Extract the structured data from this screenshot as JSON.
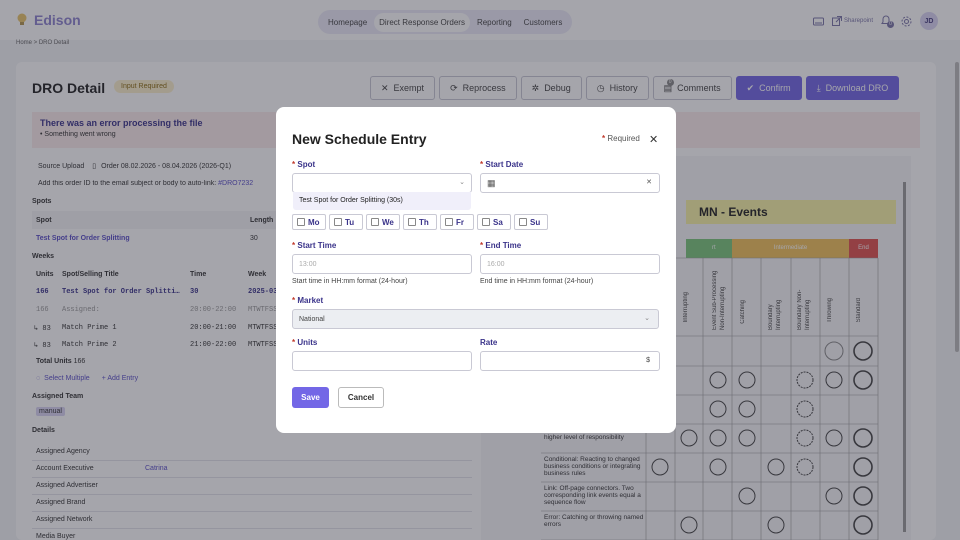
{
  "app": {
    "name": "Edison"
  },
  "nav": {
    "items": [
      "Homepage",
      "Direct Response Orders",
      "Reporting",
      "Customers"
    ]
  },
  "topright": {
    "sharepoint": "Sharepoint",
    "avatar": "JD",
    "notif_count": "0"
  },
  "breadcrumb": "Home > DRO Detail",
  "page": {
    "title": "DRO Detail",
    "status": "Input Required"
  },
  "toolbar": {
    "exempt": "Exempt",
    "reprocess": "Reprocess",
    "debug": "Debug",
    "history": "History",
    "comments": "Comments",
    "comments_count": "0",
    "confirm": "Confirm",
    "download": "Download DRO"
  },
  "error": {
    "title": "There was an error processing the file",
    "item": "Something went wrong"
  },
  "source": {
    "label": "Source Upload",
    "file": "Order 08.02.2026 - 08.04.2026 (2026-Q1)",
    "autolink": "Add this order ID to the email subject or body to auto-link:",
    "order_id": "#DRO7232"
  },
  "spots": {
    "section": "Spots",
    "col_spot": "Spot",
    "col_length": "Length",
    "row_spot": "Test Spot for Order Splitting",
    "row_length": "30"
  },
  "weeks": {
    "section": "Weeks",
    "cols": [
      "Units",
      "Spot/Selling Title",
      "Time",
      "Week"
    ],
    "rows": [
      {
        "units": "166",
        "title": "Test Spot for Order Splitti…",
        "time": "30",
        "week": "2025-03"
      },
      {
        "units": "166",
        "title": "Assigned:",
        "time": "20:00-22:00",
        "week": "MTWTFSS"
      },
      {
        "units": "↳ 83",
        "title": "Match Prime 1",
        "time": "20:00-21:00",
        "week": "MTWTFSS"
      },
      {
        "units": "↳ 83",
        "title": "Match Prime 2",
        "time": "21:00-22:00",
        "week": "MTWTFSS"
      }
    ],
    "total_label": "Total Units",
    "total": "166",
    "select_multiple": "Select Multiple",
    "add_entry": "+ Add Entry"
  },
  "team": {
    "section": "Assigned Team",
    "tag": "manual"
  },
  "details": {
    "section": "Details",
    "rows": [
      {
        "label": "Assigned Agency",
        "value": ""
      },
      {
        "label": "Account Executive",
        "value": "Catrina"
      },
      {
        "label": "Assigned Advertiser",
        "value": ""
      },
      {
        "label": "Assigned Brand",
        "value": ""
      },
      {
        "label": "Assigned Network",
        "value": ""
      },
      {
        "label": "Media Buyer",
        "value": ""
      }
    ]
  },
  "bpmn": {
    "title": "MN - Events",
    "group_start_tail": "rt",
    "group_intermediate": "Intermediate",
    "group_end": "End",
    "columns": [
      "Interrupting",
      "Event Sub-Processing Non-Interrupting",
      "Catching",
      "Boundary Interrupting",
      "Boundary Non-Interrupting",
      "Throwing",
      "Standard"
    ],
    "rows": [
      {
        "text": "higher level of responsibility"
      },
      {
        "text": "Conditional: Reacting to changed business conditions or integrating business rules"
      },
      {
        "text": "Link: Off-page connectors. Two corresponding link events equal a sequence flow"
      },
      {
        "text": "Error: Catching or throwing named errors"
      }
    ]
  },
  "modal": {
    "title": "New Schedule Entry",
    "required_note": "Required",
    "spot_label": "Spot",
    "spot_option": "Test Spot for Order Splitting (30s)",
    "start_date_label": "Start Date",
    "days": [
      "Mo",
      "Tu",
      "We",
      "Th",
      "Fr",
      "Sa",
      "Su"
    ],
    "start_time_label": "Start Time",
    "start_time_placeholder": "13:00",
    "start_time_hint": "Start time in HH:mm format (24-hour)",
    "end_time_label": "End Time",
    "end_time_placeholder": "16:00",
    "end_time_hint": "End time in HH:mm format (24-hour)",
    "market_label": "Market",
    "market_value": "National",
    "units_label": "Units",
    "rate_label": "Rate",
    "rate_currency": "$",
    "save": "Save",
    "cancel": "Cancel"
  }
}
